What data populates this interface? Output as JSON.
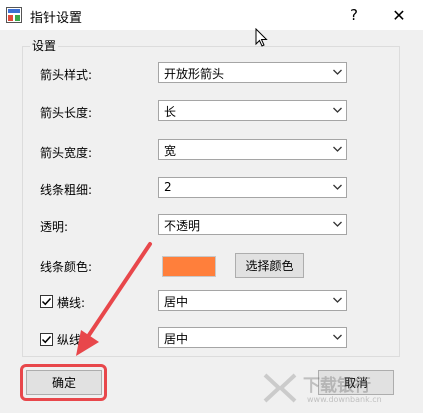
{
  "window": {
    "title": "指针设置",
    "help": "?",
    "close": "✕"
  },
  "group": {
    "legend": "设置"
  },
  "rows": [
    {
      "label": "箭头样式:",
      "value": "开放形箭头"
    },
    {
      "label": "箭头长度:",
      "value": "长"
    },
    {
      "label": "箭头宽度:",
      "value": "宽"
    },
    {
      "label": "线条粗细:",
      "value": "2"
    },
    {
      "label": "透明:",
      "value": "不透明"
    }
  ],
  "line_color": {
    "label": "线条颜色:",
    "color": "#ff7f3b",
    "button": "选择颜色"
  },
  "horizontal": {
    "label": "横线:",
    "checked": true,
    "value": "居中"
  },
  "vertical": {
    "label": "纵线:",
    "checked": true,
    "value": "居中"
  },
  "buttons": {
    "ok": "确定",
    "cancel": "取消"
  },
  "annotation": {
    "arrow_color": "#e8474b"
  },
  "watermark": {
    "main": "下载银行",
    "sub": "www.downbank.cn"
  }
}
